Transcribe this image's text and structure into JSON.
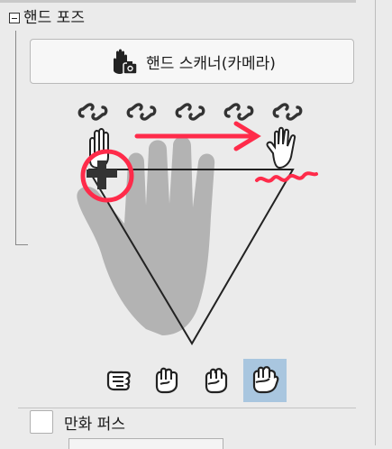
{
  "section": {
    "title": "핸드 포즈"
  },
  "scanner_button": {
    "label": "핸드 스캐너(카메라)",
    "icon": "hand-camera-icon"
  },
  "finger_links": [
    {
      "name": "thumb-link-icon"
    },
    {
      "name": "index-link-icon"
    },
    {
      "name": "middle-link-icon"
    },
    {
      "name": "ring-link-icon"
    },
    {
      "name": "pinky-link-icon"
    }
  ],
  "grip_presets": [
    {
      "name": "grip-preset-1",
      "selected": false
    },
    {
      "name": "grip-preset-2",
      "selected": false
    },
    {
      "name": "grip-preset-3",
      "selected": false
    },
    {
      "name": "grip-preset-4",
      "selected": true
    }
  ],
  "comic_perspective": {
    "label": "만화 퍼스",
    "checked": false
  },
  "colors": {
    "panel_bg": "#ebebeb",
    "selected_bg": "#a9c6df",
    "annotation_red": "#ff2b4a"
  }
}
